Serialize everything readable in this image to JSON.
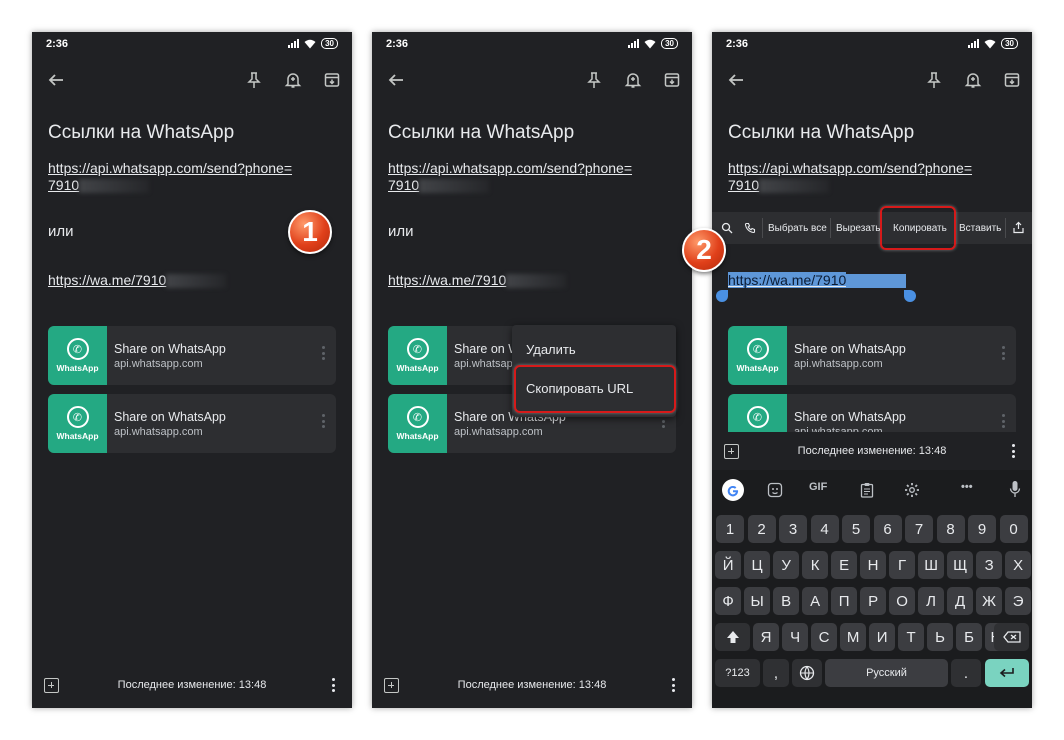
{
  "status": {
    "time": "2:36",
    "battery": "30"
  },
  "note": {
    "title": "Ссылки на WhatsApp",
    "link1_prefix": "https://api.whatsapp.com/send?phone=",
    "link1_line2": "7910",
    "ili": "или",
    "link2_prefix": "https://wa.me/7910"
  },
  "cards": [
    {
      "logo_text": "WhatsApp",
      "title": "Share on WhatsApp",
      "url": "api.whatsapp.com"
    },
    {
      "logo_text": "WhatsApp",
      "title": "Share on WhatsApp",
      "url": "api.whatsapp.com"
    }
  ],
  "bottombar": {
    "edited": "Последнее изменение: 13:48"
  },
  "badges": {
    "step1": "1",
    "step2": "2"
  },
  "context_menu": {
    "delete": "Удалить",
    "copy_url": "Скопировать URL"
  },
  "selection_toolbar": {
    "select_all": "Выбрать все",
    "cut": "Вырезать",
    "copy": "Копировать",
    "paste": "Вставить"
  },
  "keyboard": {
    "gif": "GIF",
    "more": "•••",
    "row_numbers": [
      "1",
      "2",
      "3",
      "4",
      "5",
      "6",
      "7",
      "8",
      "9",
      "0"
    ],
    "row1": [
      "Й",
      "Ц",
      "У",
      "К",
      "Е",
      "Н",
      "Г",
      "Ш",
      "Щ",
      "З",
      "Х"
    ],
    "row2": [
      "Ф",
      "Ы",
      "В",
      "А",
      "П",
      "Р",
      "О",
      "Л",
      "Д",
      "Ж",
      "Э"
    ],
    "row3": [
      "Я",
      "Ч",
      "С",
      "М",
      "И",
      "Т",
      "Ь",
      "Б",
      "Ю"
    ],
    "symbols": "?123",
    "comma": ",",
    "space": "Русский",
    "period": "."
  },
  "colors": {
    "accent": "#24a983",
    "highlight": "#d61a1a",
    "background": "#202124"
  }
}
